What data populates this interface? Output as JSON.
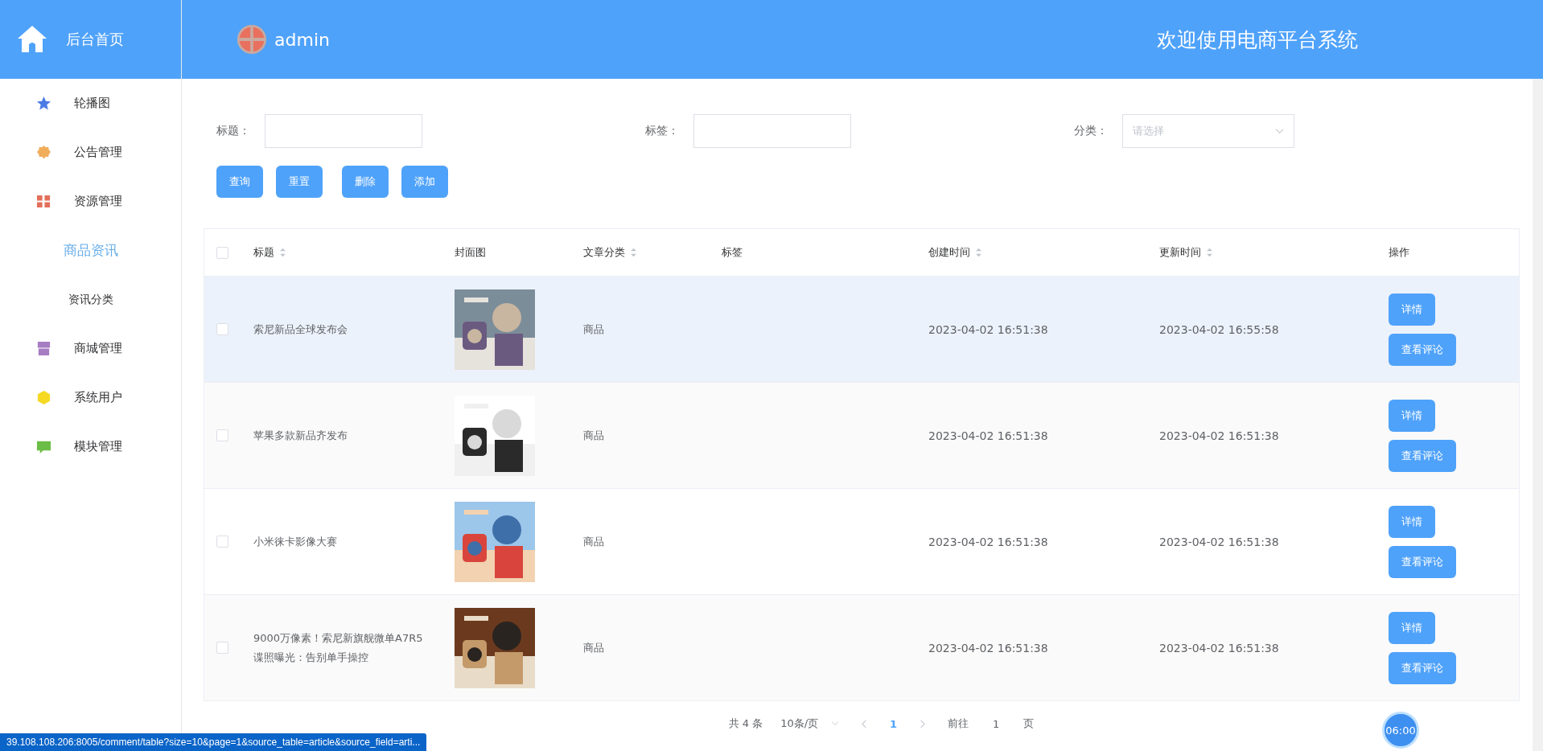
{
  "sidebar": {
    "home_label": "后台首页",
    "items": [
      {
        "label": "轮播图",
        "color": "#4b7be5",
        "selected": false
      },
      {
        "label": "公告管理",
        "color": "#f0ad5a",
        "selected": false
      },
      {
        "label": "资源管理",
        "color": "#e36f5a",
        "selected": false,
        "children": [
          {
            "label": "商品资讯",
            "selected": true
          },
          {
            "label": "资讯分类",
            "selected": false
          }
        ]
      },
      {
        "label": "商城管理",
        "color": "#a77dc2",
        "selected": false
      },
      {
        "label": "系统用户",
        "color": "#f5d923",
        "selected": false
      },
      {
        "label": "模块管理",
        "color": "#6cbd45",
        "selected": false
      }
    ]
  },
  "header": {
    "user": "admin",
    "title": "欢迎使用电商平台系统"
  },
  "filters": [
    {
      "label": "标题：",
      "kind": "text"
    },
    {
      "label": "标签：",
      "kind": "text"
    },
    {
      "label": "分类：",
      "kind": "select",
      "placeholder": "请选择"
    }
  ],
  "buttons": [
    "查询",
    "重置",
    "删除",
    "添加"
  ],
  "table": {
    "all_checked": false,
    "columns": [
      {
        "label": "标题",
        "sortable": true
      },
      {
        "label": "封面图",
        "sortable": false
      },
      {
        "label": "文章分类",
        "sortable": true
      },
      {
        "label": "标签",
        "sortable": false
      },
      {
        "label": "创建时间",
        "sortable": true
      },
      {
        "label": "更新时间",
        "sortable": true
      },
      {
        "label": "操作",
        "sortable": false
      }
    ],
    "rows": [
      {
        "checked": false,
        "highlighted": true,
        "title": "索尼新品全球发布会",
        "cover": {
          "kind": "picture"
        },
        "category": "商品",
        "created": "2023-04-02 16:51:38",
        "updated": "2023-04-02 16:55:58",
        "actions": [
          "详情",
          "查看评论"
        ]
      },
      {
        "checked": false,
        "highlighted": false,
        "title": "苹果多款新品齐发布",
        "cover": {
          "kind": "picture"
        },
        "category": "商品",
        "created": "2023-04-02 16:51:38",
        "updated": "2023-04-02 16:51:38",
        "actions": [
          "详情",
          "查看评论"
        ]
      },
      {
        "checked": false,
        "highlighted": false,
        "title": "小米徕卡影像大赛",
        "cover": {
          "kind": "picture"
        },
        "category": "商品",
        "created": "2023-04-02 16:51:38",
        "updated": "2023-04-02 16:51:38",
        "actions": [
          "详情",
          "查看评论"
        ]
      },
      {
        "checked": false,
        "highlighted": false,
        "title": "9000万像素！索尼新旗舰微单A7R5谍照曝光：告别单手操控",
        "cover": {
          "kind": "picture"
        },
        "category": "商品",
        "created": "2023-04-02 16:51:38",
        "updated": "2023-04-02 16:51:38",
        "actions": [
          "详情",
          "查看评论"
        ]
      }
    ]
  },
  "pagination": {
    "total": "共 4 条",
    "page_size": "10条/页",
    "pages": [
      {
        "label": "1",
        "selected": true
      }
    ],
    "goto_label": "前往",
    "goto_value": "1",
    "goto_suffix": "页"
  },
  "timer": "06:00",
  "status_url": "39.108.108.206:8005/comment/table?size=10&page=1&source_table=article&source_field=arti..."
}
